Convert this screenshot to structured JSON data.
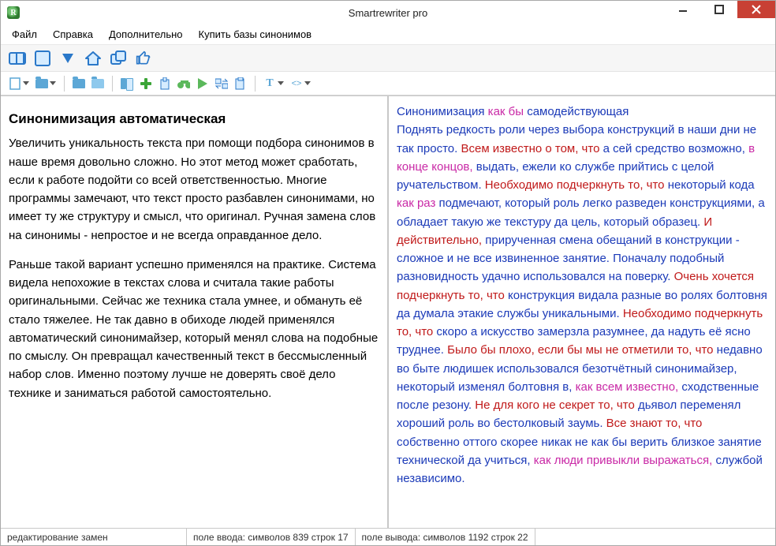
{
  "app": {
    "title": "Smartrewriter pro"
  },
  "menu": {
    "items": [
      "Файл",
      "Справка",
      "Дополнительно",
      "Купить базы синонимов"
    ]
  },
  "left": {
    "heading": "Синонимизация автоматическая",
    "para1": "Увеличить уникальность текста при помощи подбора синонимов в наше время довольно сложно. Но этот метод может сработать, если к работе подойти со всей ответственностью. Многие программы замечают, что текст просто разбавлен синонимами, но имеет ту же структуру и смысл, что оригинал. Ручная замена слов на синонимы - непростое и не всегда оправданное дело.",
    "para2": "Раньше такой вариант успешно применялся на практике. Система видела непохожие в текстах слова и считала такие работы оригинальными. Сейчас же техника стала умнее, и обмануть её стало тяжелее. Не так давно в обиходе людей применялся автоматический синонимайзер, который менял слова на подобные по смыслу. Он превращал качественный текст в бессмысленный набор слов. Именно поэтому лучше не доверять своё дело технике и заниматься работой самостоятельно."
  },
  "right": {
    "segments": [
      [
        "blue",
        "Синонимизация "
      ],
      [
        "pink",
        "как бы "
      ],
      [
        "blue",
        "самодействующая"
      ],
      [
        "br"
      ],
      [
        "blue",
        "Поднять редкость роли через выбора конструкций в наши дни не так просто. "
      ],
      [
        "red",
        "Всем известно о том, что "
      ],
      [
        "blue",
        "а сей средство возможно, "
      ],
      [
        "pink",
        "в конце концов, "
      ],
      [
        "blue",
        "выдать, ежели ко службе прийтись с целой ручательством. "
      ],
      [
        "red",
        "Необходимо подчеркнуть то, что "
      ],
      [
        "blue",
        "некоторый кода "
      ],
      [
        "pink",
        "как раз "
      ],
      [
        "blue",
        "подмечают, который роль легко разведен конструкциями, а обладает такую же текстуру да цель, который образец. "
      ],
      [
        "red",
        "И действительно, "
      ],
      [
        "blue",
        "прирученная смена обещаний в конструкции - сложное и не все извиненное занятие. Поначалу подобный разновидность удачно использовался на поверку. "
      ],
      [
        "red",
        "Очень хочется подчеркнуть то, что "
      ],
      [
        "blue",
        "конструкция видала разные во ролях болтовня да думала этакие службы уникальными. "
      ],
      [
        "red",
        "Необходимо подчеркнуть то, что "
      ],
      [
        "blue",
        "скоро а искусство замерзла разумнее, да надуть её ясно труднее. "
      ],
      [
        "red",
        "Было бы плохо, если бы мы не отметили то, что "
      ],
      [
        "blue",
        "недавно во быте людишек использовался безотчётный синонимайзер, некоторый изменял болтовня в, "
      ],
      [
        "pink",
        "как всем известно, "
      ],
      [
        "blue",
        "сходственные после резону. "
      ],
      [
        "red",
        "Не для кого не секрет то, что "
      ],
      [
        "blue",
        "дьявол переменял хороший роль во бестолковый заумь. "
      ],
      [
        "red",
        "Все знают то, что "
      ],
      [
        "blue",
        "собственно оттого скорее никак не как бы верить близкое занятие технической да учиться, "
      ],
      [
        "pink",
        "как люди привыкли выражаться, "
      ],
      [
        "blue",
        "службой независимо."
      ]
    ]
  },
  "status": {
    "cell1": "редактирование замен",
    "cell2": "поле ввода: символов 839 строк 17",
    "cell3": "поле вывода: символов 1192 строк 22"
  }
}
